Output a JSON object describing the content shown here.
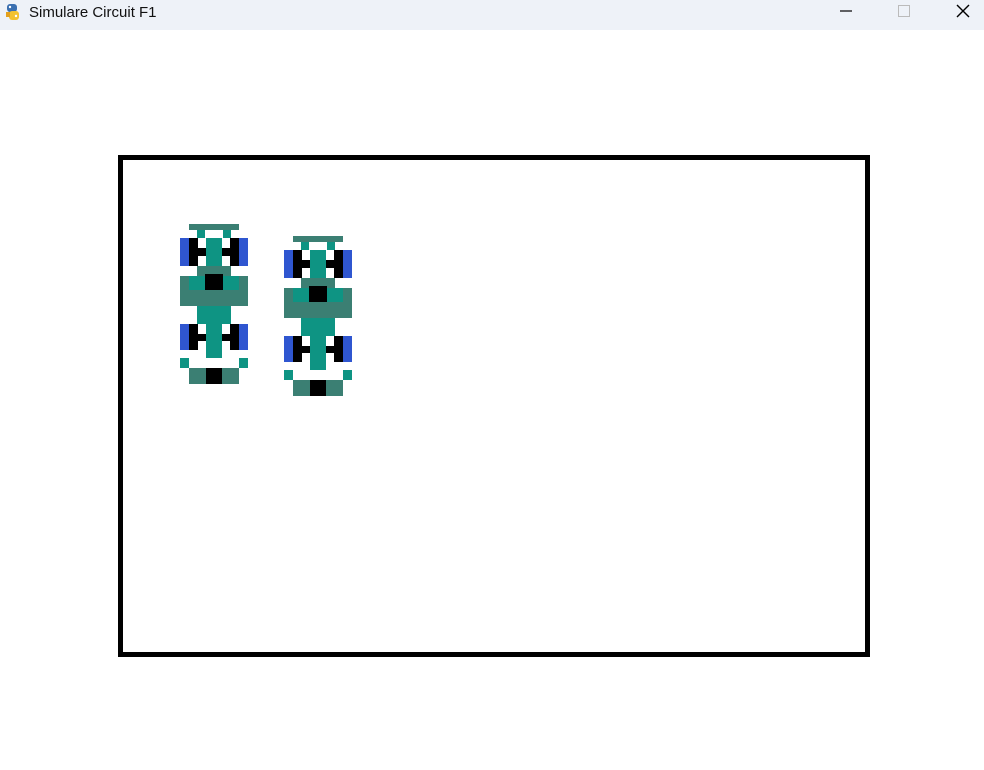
{
  "window": {
    "title": "Simulare Circuit F1",
    "app_icon": "python-snake-icon",
    "controls": {
      "minimize_icon": "minimize-icon",
      "maximize_icon": "maximize-icon",
      "close_icon": "close-icon"
    }
  },
  "colors": {
    "titlebar_bg": "#eef2f8",
    "track_border": "#000000",
    "car_body_primary": "#0e9483",
    "car_body_shade": "#3b7f73",
    "car_tire_outer": "#2f56d0",
    "car_tire_inner": "#000000"
  },
  "scene": {
    "track": "rectangular-circuit-outline",
    "cars": [
      {
        "id": "car-1",
        "type": "f1-car-sprite"
      },
      {
        "id": "car-2",
        "type": "f1-car-sprite"
      }
    ]
  }
}
